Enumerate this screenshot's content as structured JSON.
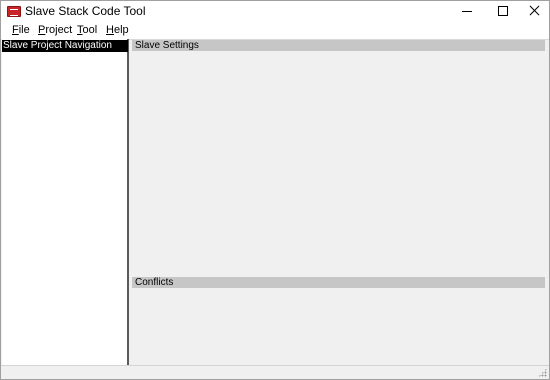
{
  "window": {
    "title": "Slave Stack Code Tool",
    "icon": "ssc-app-icon",
    "controls": [
      "minimize-icon",
      "maximize-icon",
      "close-icon"
    ]
  },
  "menubar": {
    "items": [
      {
        "label_rest": "ile",
        "mnemonic": "F"
      },
      {
        "label_rest": "roject",
        "mnemonic": "P"
      },
      {
        "label_rest": "ool",
        "mnemonic": "T"
      },
      {
        "label_rest": "elp",
        "mnemonic": "H"
      }
    ]
  },
  "navigation": {
    "header": "Slave Project Navigation"
  },
  "settings": {
    "header": "Slave Settings"
  },
  "conflicts": {
    "header": "Conflicts"
  }
}
